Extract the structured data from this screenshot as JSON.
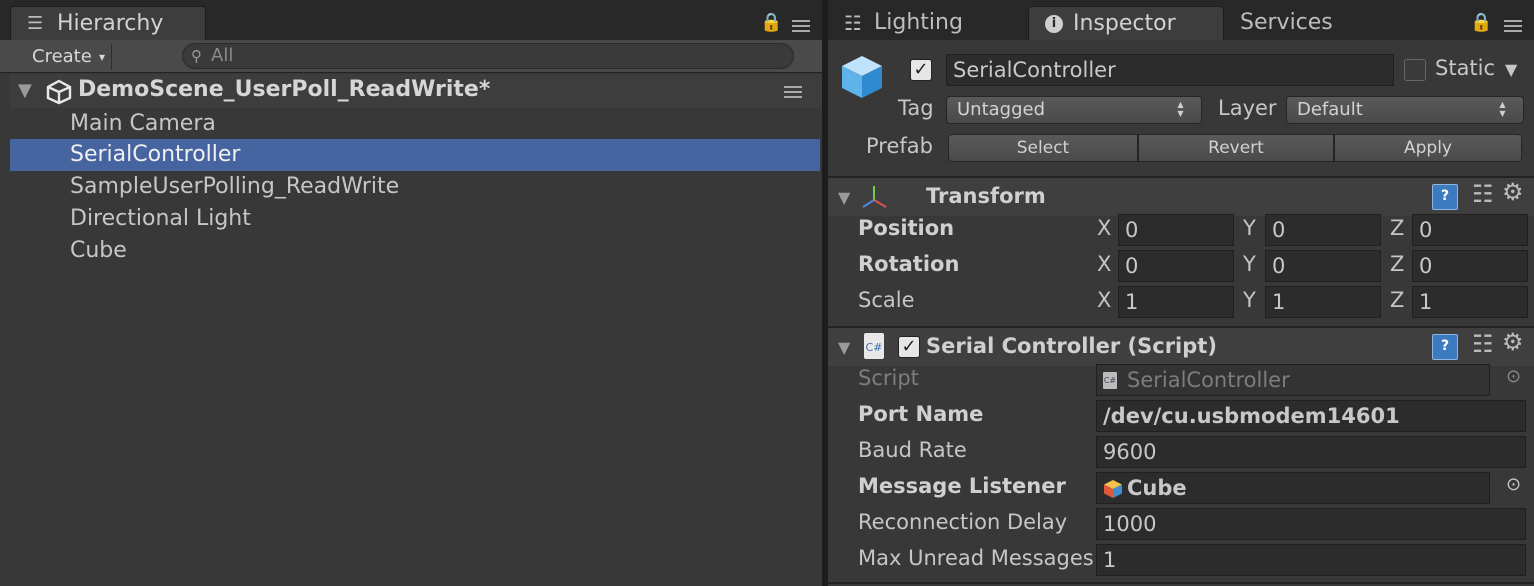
{
  "hierarchy": {
    "tab_label": "Hierarchy",
    "create_label": "Create",
    "search_placeholder": "All",
    "scene_name": "DemoScene_UserPoll_ReadWrite*",
    "items": [
      {
        "label": "Main Camera",
        "selected": false
      },
      {
        "label": "SerialController",
        "selected": true
      },
      {
        "label": "SampleUserPolling_ReadWrite",
        "selected": false
      },
      {
        "label": "Directional Light",
        "selected": false
      },
      {
        "label": "Cube",
        "selected": false
      }
    ]
  },
  "inspector_tabs": {
    "lighting": "Lighting",
    "inspector": "Inspector",
    "services": "Services"
  },
  "object": {
    "active": true,
    "name": "SerialController",
    "static_label": "Static",
    "static": false,
    "tag_label": "Tag",
    "tag_value": "Untagged",
    "layer_label": "Layer",
    "layer_value": "Default",
    "prefab_label": "Prefab",
    "prefab_buttons": [
      "Select",
      "Revert",
      "Apply"
    ]
  },
  "transform": {
    "title": "Transform",
    "axes": [
      "X",
      "Y",
      "Z"
    ],
    "rows": [
      {
        "label": "Position",
        "x": "0",
        "y": "0",
        "z": "0"
      },
      {
        "label": "Rotation",
        "x": "0",
        "y": "0",
        "z": "0"
      },
      {
        "label": "Scale",
        "x": "1",
        "y": "1",
        "z": "1"
      }
    ]
  },
  "serial_controller": {
    "title": "Serial Controller (Script)",
    "enabled": true,
    "script_icon_text": "C#",
    "fields": {
      "script": {
        "label": "Script",
        "value": "SerialController"
      },
      "port_name": {
        "label": "Port Name",
        "value": "/dev/cu.usbmodem14601"
      },
      "baud_rate": {
        "label": "Baud Rate",
        "value": "9600"
      },
      "message_listener": {
        "label": "Message Listener",
        "value": "Cube"
      },
      "reconnection_delay": {
        "label": "Reconnection Delay",
        "value": "1000"
      },
      "max_unread": {
        "label": "Max Unread Messages",
        "value": "1"
      }
    }
  },
  "glyphs": {
    "check": "✓",
    "fold_down": "▼",
    "select_arrows": "▲▼",
    "dropdown_caret": "▾",
    "target": "⊙",
    "help": "?",
    "gear": "⚙"
  },
  "colors": {
    "selection": "#4664a0",
    "panel_bg": "#383838",
    "tabbar_bg": "#282828"
  }
}
